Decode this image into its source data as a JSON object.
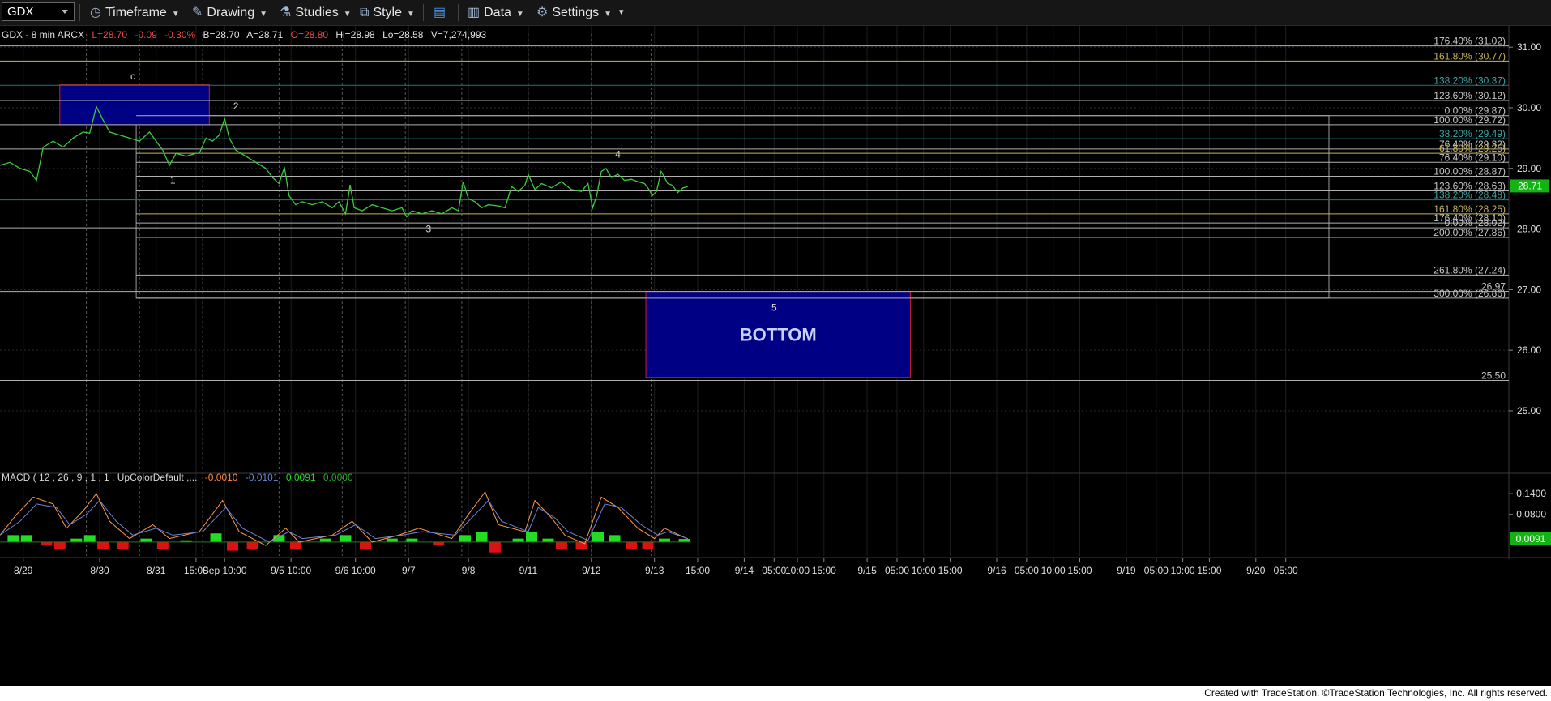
{
  "toolbar": {
    "symbol": "GDX",
    "timeframe_label": "Timeframe",
    "drawing_label": "Drawing",
    "studies_label": "Studies",
    "style_label": "Style",
    "data_label": "Data",
    "settings_label": "Settings"
  },
  "quote": {
    "name": "GDX - 8 min ARCX",
    "last": "L=28.70",
    "change": "-0.09",
    "pct": "-0.30%",
    "bid": "B=28.70",
    "ask": "A=28.71",
    "open": "O=28.80",
    "high": "Hi=28.98",
    "low": "Lo=28.58",
    "volume": "V=7,274,993"
  },
  "macd_header": {
    "label": "MACD ( 12 , 26 , 9 , 1 , 1 , UpColorDefault ,...",
    "v1": "-0.0010",
    "v2": "-0.0101",
    "v3": "0.0091",
    "v4": "0.0000"
  },
  "footer_text": "Created with TradeStation. ©TradeStation Technologies, Inc. All rights reserved.",
  "colors": {
    "price": "#3ccc3c",
    "grid": "#2b2b2b",
    "fib_line": "#b0b0b0",
    "fib_label_default": "#c8c8c8",
    "fib_label_gold": "#c8b25a",
    "fib_label_teal": "#3fa5a5",
    "target_box": "#000085",
    "target_border": "#cc1f1f",
    "macd_line": "#ff9a4a",
    "signal_line": "#6f84d6",
    "hist_up": "#22dd22",
    "hist_down": "#dd1111",
    "last_price_bg": "#12b312"
  },
  "chart_data": {
    "type": "line",
    "title": "GDX - 8 min ARCX",
    "ylim": [
      24.05,
      31.35
    ],
    "y_ticks": [
      31.0,
      30.0,
      29.0,
      28.0,
      27.0,
      26.0,
      25.0
    ],
    "x_tick_labels": [
      {
        "label": "8/29",
        "t": 0.35
      },
      {
        "label": "8/30",
        "t": 1.5
      },
      {
        "label": "8/31",
        "t": 2.35
      },
      {
        "label": "15:00",
        "t": 2.95
      },
      {
        "label": "Sep 10:00",
        "t": 3.38
      },
      {
        "label": "9/5 10:00",
        "t": 4.38
      },
      {
        "label": "9/6 10:00",
        "t": 5.35
      },
      {
        "label": "9/7",
        "t": 6.15
      },
      {
        "label": "9/8",
        "t": 7.05
      },
      {
        "label": "9/11",
        "t": 7.95
      },
      {
        "label": "9/12",
        "t": 8.9
      },
      {
        "label": "9/13",
        "t": 9.85
      },
      {
        "label": "15:00",
        "t": 10.5
      },
      {
        "label": "9/14",
        "t": 11.2
      },
      {
        "label": "05:00",
        "t": 11.65
      },
      {
        "label": "10:00",
        "t": 12.0
      },
      {
        "label": "15:00",
        "t": 12.4
      },
      {
        "label": "9/15",
        "t": 13.05
      },
      {
        "label": "05:00",
        "t": 13.5
      },
      {
        "label": "10:00",
        "t": 13.9
      },
      {
        "label": "15:00",
        "t": 14.3
      },
      {
        "label": "9/16",
        "t": 15.0
      },
      {
        "label": "05:00",
        "t": 15.45
      },
      {
        "label": "10:00",
        "t": 15.85
      },
      {
        "label": "15:00",
        "t": 16.25
      },
      {
        "label": "9/19",
        "t": 16.95
      },
      {
        "label": "05:00",
        "t": 17.4
      },
      {
        "label": "10:00",
        "t": 17.8
      },
      {
        "label": "15:00",
        "t": 18.2
      },
      {
        "label": "9/20",
        "t": 18.9
      },
      {
        "label": "05:00",
        "t": 19.35
      }
    ],
    "day_dividers": [
      1.3,
      2.1,
      3.05,
      4.2,
      5.15,
      6.1,
      6.95,
      7.95,
      8.9,
      9.8
    ],
    "last_price": 28.71,
    "last_price_label": "28.71",
    "series": [
      {
        "values": [
          [
            0.0,
            29.05
          ],
          [
            0.15,
            29.1
          ],
          [
            0.3,
            29.0
          ],
          [
            0.45,
            28.95
          ],
          [
            0.55,
            28.8
          ],
          [
            0.65,
            29.35
          ],
          [
            0.8,
            29.45
          ],
          [
            0.95,
            29.35
          ],
          [
            1.1,
            29.5
          ],
          [
            1.25,
            29.6
          ],
          [
            1.35,
            29.58
          ],
          [
            1.45,
            30.02
          ],
          [
            1.55,
            29.8
          ],
          [
            1.65,
            29.6
          ],
          [
            1.8,
            29.55
          ],
          [
            1.95,
            29.5
          ],
          [
            2.1,
            29.45
          ],
          [
            2.25,
            29.6
          ],
          [
            2.35,
            29.45
          ],
          [
            2.45,
            29.3
          ],
          [
            2.55,
            29.05
          ],
          [
            2.65,
            29.25
          ],
          [
            2.8,
            29.2
          ],
          [
            2.95,
            29.25
          ],
          [
            3.0,
            29.25
          ],
          [
            3.1,
            29.5
          ],
          [
            3.2,
            29.45
          ],
          [
            3.3,
            29.55
          ],
          [
            3.38,
            29.82
          ],
          [
            3.45,
            29.5
          ],
          [
            3.55,
            29.3
          ],
          [
            3.7,
            29.2
          ],
          [
            3.85,
            29.1
          ],
          [
            4.0,
            29.0
          ],
          [
            4.1,
            28.85
          ],
          [
            4.2,
            28.75
          ],
          [
            4.28,
            29.02
          ],
          [
            4.35,
            28.55
          ],
          [
            4.45,
            28.4
          ],
          [
            4.55,
            28.45
          ],
          [
            4.7,
            28.4
          ],
          [
            4.85,
            28.45
          ],
          [
            5.0,
            28.35
          ],
          [
            5.1,
            28.45
          ],
          [
            5.2,
            28.25
          ],
          [
            5.27,
            28.73
          ],
          [
            5.33,
            28.35
          ],
          [
            5.45,
            28.3
          ],
          [
            5.6,
            28.4
          ],
          [
            5.75,
            28.35
          ],
          [
            5.9,
            28.3
          ],
          [
            6.05,
            28.35
          ],
          [
            6.12,
            28.2
          ],
          [
            6.2,
            28.3
          ],
          [
            6.35,
            28.25
          ],
          [
            6.5,
            28.3
          ],
          [
            6.65,
            28.25
          ],
          [
            6.8,
            28.35
          ],
          [
            6.9,
            28.3
          ],
          [
            6.97,
            28.78
          ],
          [
            7.05,
            28.5
          ],
          [
            7.15,
            28.45
          ],
          [
            7.25,
            28.35
          ],
          [
            7.35,
            28.4
          ],
          [
            7.5,
            28.38
          ],
          [
            7.6,
            28.35
          ],
          [
            7.7,
            28.7
          ],
          [
            7.8,
            28.62
          ],
          [
            7.9,
            28.72
          ],
          [
            7.95,
            28.9
          ],
          [
            8.05,
            28.65
          ],
          [
            8.15,
            28.75
          ],
          [
            8.3,
            28.68
          ],
          [
            8.45,
            28.78
          ],
          [
            8.6,
            28.65
          ],
          [
            8.75,
            28.62
          ],
          [
            8.85,
            28.75
          ],
          [
            8.92,
            28.35
          ],
          [
            8.98,
            28.55
          ],
          [
            9.05,
            28.95
          ],
          [
            9.12,
            29.0
          ],
          [
            9.2,
            28.85
          ],
          [
            9.3,
            28.9
          ],
          [
            9.4,
            28.8
          ],
          [
            9.5,
            28.82
          ],
          [
            9.6,
            28.78
          ],
          [
            9.7,
            28.75
          ],
          [
            9.75,
            28.68
          ],
          [
            9.82,
            28.55
          ],
          [
            9.88,
            28.62
          ],
          [
            9.95,
            28.95
          ],
          [
            10.05,
            28.75
          ],
          [
            10.12,
            28.72
          ],
          [
            10.2,
            28.6
          ],
          [
            10.28,
            28.68
          ],
          [
            10.35,
            28.7
          ]
        ]
      }
    ],
    "fib_levels": [
      {
        "label": "176.40% (31.02)",
        "price": 31.02,
        "x_start": 0.0,
        "color": "default"
      },
      {
        "label": "161.80% (30.77)",
        "price": 30.77,
        "x_start": 0.0,
        "color": "gold"
      },
      {
        "label": "138.20% (30.37)",
        "price": 30.37,
        "x_start": 0.0,
        "color": "teal"
      },
      {
        "label": "123.60% (30.12)",
        "price": 30.12,
        "x_start": 0.0,
        "color": "default"
      },
      {
        "label": "0.00% (29.87)",
        "price": 29.87,
        "x_start": 2.05,
        "color": "default"
      },
      {
        "label": "100.00% (29.72)",
        "price": 29.72,
        "x_start": 0.0,
        "color": "default"
      },
      {
        "label": "38.20% (29.49)",
        "price": 29.49,
        "x_start": 2.05,
        "color": "teal"
      },
      {
        "label": "76.40% (29.32)",
        "price": 29.32,
        "x_start": 0.0,
        "color": "default"
      },
      {
        "label": "61.80% (29.25)",
        "price": 29.25,
        "x_start": 2.05,
        "color": "gold"
      },
      {
        "label": "76.40% (29.10)",
        "price": 29.1,
        "x_start": 2.05,
        "color": "default"
      },
      {
        "label": "100.00% (28.87)",
        "price": 28.87,
        "x_start": 2.05,
        "color": "default"
      },
      {
        "label": "123.60% (28.63)",
        "price": 28.63,
        "x_start": 2.05,
        "color": "default"
      },
      {
        "label": "138.20% (28.48)",
        "price": 28.48,
        "x_start": 0.0,
        "color": "teal"
      },
      {
        "label": "161.80% (28.25)",
        "price": 28.25,
        "x_start": 2.05,
        "color": "gold"
      },
      {
        "label": "176.40% (28.10)",
        "price": 28.1,
        "x_start": 2.05,
        "color": "default"
      },
      {
        "label": "0.00% (28.02)",
        "price": 28.02,
        "x_start": 0.0,
        "color": "default"
      },
      {
        "label": "200.00% (27.86)",
        "price": 27.86,
        "x_start": 2.05,
        "color": "default"
      },
      {
        "label": "261.80% (27.24)",
        "price": 27.24,
        "x_start": 2.05,
        "color": "default"
      },
      {
        "label": "26.97",
        "price": 26.97,
        "x_start": 0.0,
        "color": "default"
      },
      {
        "label": "300.00% (26.86)",
        "price": 26.86,
        "x_start": 2.05,
        "color": "default"
      },
      {
        "label": "25.50",
        "price": 25.5,
        "x_start": 0.0,
        "color": "default"
      }
    ],
    "retracement_box": {
      "x0": 2.05,
      "x1": 20.0,
      "y0": 29.87,
      "y1": 26.86
    },
    "target_zones": [
      {
        "name": "c",
        "x0": 0.9,
        "x1": 3.15,
        "y_top": 30.38,
        "y_bottom": 29.72,
        "label": ""
      },
      {
        "name": "bottom",
        "x0": 9.72,
        "x1": 13.7,
        "y_top": 26.97,
        "y_bottom": 25.55,
        "label": "BOTTOM"
      }
    ],
    "wave_labels": [
      {
        "text": "c",
        "t": 2.0,
        "y": 30.47
      },
      {
        "text": "2",
        "t": 3.55,
        "y": 29.97
      },
      {
        "text": "1",
        "t": 2.6,
        "y": 28.75
      },
      {
        "text": "3",
        "t": 6.45,
        "y": 27.95
      },
      {
        "text": "4",
        "t": 9.3,
        "y": 29.18
      },
      {
        "text": "5",
        "t": 11.65,
        "y": 26.65
      }
    ],
    "macd": {
      "ylim": [
        -0.04,
        0.18
      ],
      "y_ticks": [
        0.14,
        0.08
      ],
      "last_label": "0.0091",
      "tick_labels": [
        "0.1400",
        "0.0800"
      ],
      "macd_line": [
        [
          0.0,
          0.02
        ],
        [
          0.25,
          0.08
        ],
        [
          0.5,
          0.13
        ],
        [
          0.8,
          0.11
        ],
        [
          1.0,
          0.04
        ],
        [
          1.25,
          0.09
        ],
        [
          1.45,
          0.14
        ],
        [
          1.65,
          0.06
        ],
        [
          1.95,
          0.01
        ],
        [
          2.3,
          0.05
        ],
        [
          2.55,
          0.01
        ],
        [
          3.0,
          0.03
        ],
        [
          3.35,
          0.12
        ],
        [
          3.6,
          0.03
        ],
        [
          4.0,
          -0.01
        ],
        [
          4.3,
          0.04
        ],
        [
          4.5,
          0.0
        ],
        [
          5.0,
          0.02
        ],
        [
          5.3,
          0.06
        ],
        [
          5.6,
          0.0
        ],
        [
          6.0,
          0.02
        ],
        [
          6.3,
          0.04
        ],
        [
          6.8,
          0.01
        ],
        [
          7.05,
          0.08
        ],
        [
          7.3,
          0.145
        ],
        [
          7.5,
          0.05
        ],
        [
          7.9,
          0.03
        ],
        [
          8.05,
          0.12
        ],
        [
          8.3,
          0.07
        ],
        [
          8.5,
          0.02
        ],
        [
          8.8,
          -0.005
        ],
        [
          9.05,
          0.13
        ],
        [
          9.3,
          0.1
        ],
        [
          9.6,
          0.04
        ],
        [
          9.85,
          0.01
        ],
        [
          10.0,
          0.04
        ],
        [
          10.35,
          0.009
        ]
      ],
      "signal_line": [
        [
          0.0,
          0.02
        ],
        [
          0.3,
          0.06
        ],
        [
          0.55,
          0.11
        ],
        [
          0.85,
          0.1
        ],
        [
          1.05,
          0.05
        ],
        [
          1.3,
          0.08
        ],
        [
          1.5,
          0.12
        ],
        [
          1.75,
          0.06
        ],
        [
          2.0,
          0.02
        ],
        [
          2.35,
          0.04
        ],
        [
          2.6,
          0.02
        ],
        [
          3.05,
          0.03
        ],
        [
          3.4,
          0.1
        ],
        [
          3.65,
          0.04
        ],
        [
          4.05,
          0.0
        ],
        [
          4.35,
          0.03
        ],
        [
          4.55,
          0.01
        ],
        [
          5.05,
          0.02
        ],
        [
          5.35,
          0.05
        ],
        [
          5.65,
          0.01
        ],
        [
          6.05,
          0.02
        ],
        [
          6.35,
          0.03
        ],
        [
          6.85,
          0.02
        ],
        [
          7.1,
          0.07
        ],
        [
          7.35,
          0.12
        ],
        [
          7.55,
          0.06
        ],
        [
          7.95,
          0.03
        ],
        [
          8.1,
          0.1
        ],
        [
          8.35,
          0.07
        ],
        [
          8.55,
          0.03
        ],
        [
          8.85,
          0.005
        ],
        [
          9.1,
          0.11
        ],
        [
          9.35,
          0.1
        ],
        [
          9.65,
          0.05
        ],
        [
          9.9,
          0.02
        ],
        [
          10.05,
          0.03
        ],
        [
          10.35,
          0.01
        ]
      ],
      "histogram": [
        [
          0.2,
          0.02
        ],
        [
          0.4,
          0.02
        ],
        [
          0.7,
          -0.01
        ],
        [
          0.9,
          -0.02
        ],
        [
          1.15,
          0.01
        ],
        [
          1.35,
          0.02
        ],
        [
          1.55,
          -0.02
        ],
        [
          1.85,
          -0.02
        ],
        [
          2.2,
          0.01
        ],
        [
          2.45,
          -0.02
        ],
        [
          2.8,
          0.005
        ],
        [
          3.25,
          0.025
        ],
        [
          3.5,
          -0.025
        ],
        [
          3.8,
          -0.02
        ],
        [
          4.2,
          0.02
        ],
        [
          4.45,
          -0.02
        ],
        [
          4.9,
          0.01
        ],
        [
          5.2,
          0.02
        ],
        [
          5.5,
          -0.02
        ],
        [
          5.9,
          0.01
        ],
        [
          6.2,
          0.01
        ],
        [
          6.6,
          -0.01
        ],
        [
          7.0,
          0.02
        ],
        [
          7.25,
          0.03
        ],
        [
          7.45,
          -0.03
        ],
        [
          7.8,
          0.01
        ],
        [
          8.0,
          0.03
        ],
        [
          8.25,
          0.01
        ],
        [
          8.45,
          -0.02
        ],
        [
          8.75,
          -0.02
        ],
        [
          9.0,
          0.03
        ],
        [
          9.25,
          0.02
        ],
        [
          9.5,
          -0.02
        ],
        [
          9.75,
          -0.02
        ],
        [
          10.0,
          0.01
        ],
        [
          10.3,
          0.009
        ]
      ]
    }
  }
}
